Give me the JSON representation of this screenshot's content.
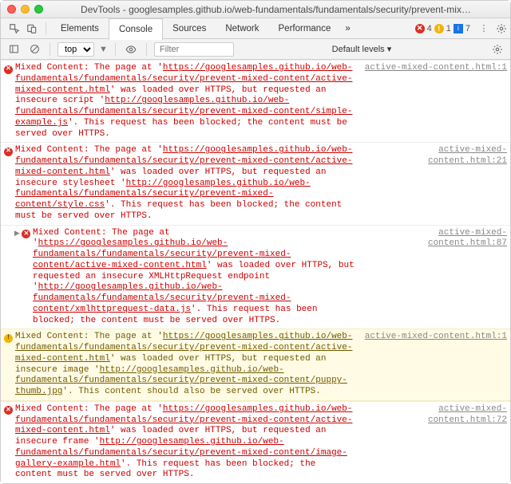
{
  "window": {
    "title": "DevTools - googlesamples.github.io/web-fundamentals/fundamentals/security/prevent-mix…"
  },
  "tabs": {
    "items": [
      "Elements",
      "Console",
      "Sources",
      "Network",
      "Performance"
    ],
    "overflow_icon": "»",
    "status": {
      "errors": 4,
      "warnings": 1,
      "info": 7
    }
  },
  "toolbar": {
    "context": "top",
    "filter_placeholder": "Filter",
    "levels": "Default levels ▾"
  },
  "entries": [
    {
      "type": "error",
      "src": "active-mixed-content.html:1",
      "prefix": "Mixed Content: The page at '",
      "url1": "https://googlesamples.github.io/web-fundamentals/fundamentals/security/prevent-mixed-content/active-mixed-content.html",
      "mid": "' was loaded over HTTPS, but requested an insecure script '",
      "url2": "http://googlesamples.github.io/web-fundamentals/fundamentals/security/prevent-mixed-content/simple-example.js",
      "suffix": "'. This request has been blocked; the content must be served over HTTPS."
    },
    {
      "type": "error",
      "src": "active-mixed-content.html:21",
      "prefix": "Mixed Content: The page at '",
      "url1": "https://googlesamples.github.io/web-fundamentals/fundamentals/security/prevent-mixed-content/active-mixed-content.html",
      "mid": "' was loaded over HTTPS, but requested an insecure stylesheet '",
      "url2": "http://googlesamples.github.io/web-fundamentals/fundamentals/security/prevent-mixed-content/style.css",
      "suffix": "'. This request has been blocked; the content must be served over HTTPS."
    },
    {
      "type": "error",
      "indent": true,
      "src": "active-mixed-content.html:87",
      "prefix": "Mixed Content: The page at '",
      "url1": "https://googlesamples.github.io/web-fundamentals/fundamentals/security/prevent-mixed-content/active-mixed-content.html",
      "mid": "' was loaded over HTTPS, but requested an insecure XMLHttpRequest endpoint '",
      "url2": "http://googlesamples.github.io/web-fundamentals/fundamentals/security/prevent-mixed-content/xmlhttprequest-data.js",
      "suffix": "'. This request has been blocked; the content must be served over HTTPS."
    },
    {
      "type": "warning",
      "src": "active-mixed-content.html:1",
      "prefix": "Mixed Content: The page at '",
      "url1": "https://googlesamples.github.io/web-fundamentals/fundamentals/security/prevent-mixed-content/active-mixed-content.html",
      "mid": "' was loaded over HTTPS, but requested an insecure image '",
      "url2": "http://googlesamples.github.io/web-fundamentals/fundamentals/security/prevent-mixed-content/puppy-thumb.jpg",
      "suffix": "'. This content should also be served over HTTPS."
    },
    {
      "type": "error",
      "src": "active-mixed-content.html:72",
      "prefix": "Mixed Content: The page at '",
      "url1": "https://googlesamples.github.io/web-fundamentals/fundamentals/security/prevent-mixed-content/active-mixed-content.html",
      "mid": "' was loaded over HTTPS, but requested an insecure frame '",
      "url2": "http://googlesamples.github.io/web-fundamentals/fundamentals/security/prevent-mixed-content/image-gallery-example.html",
      "suffix": "'. This request has been blocked; the content must be served over HTTPS."
    }
  ]
}
